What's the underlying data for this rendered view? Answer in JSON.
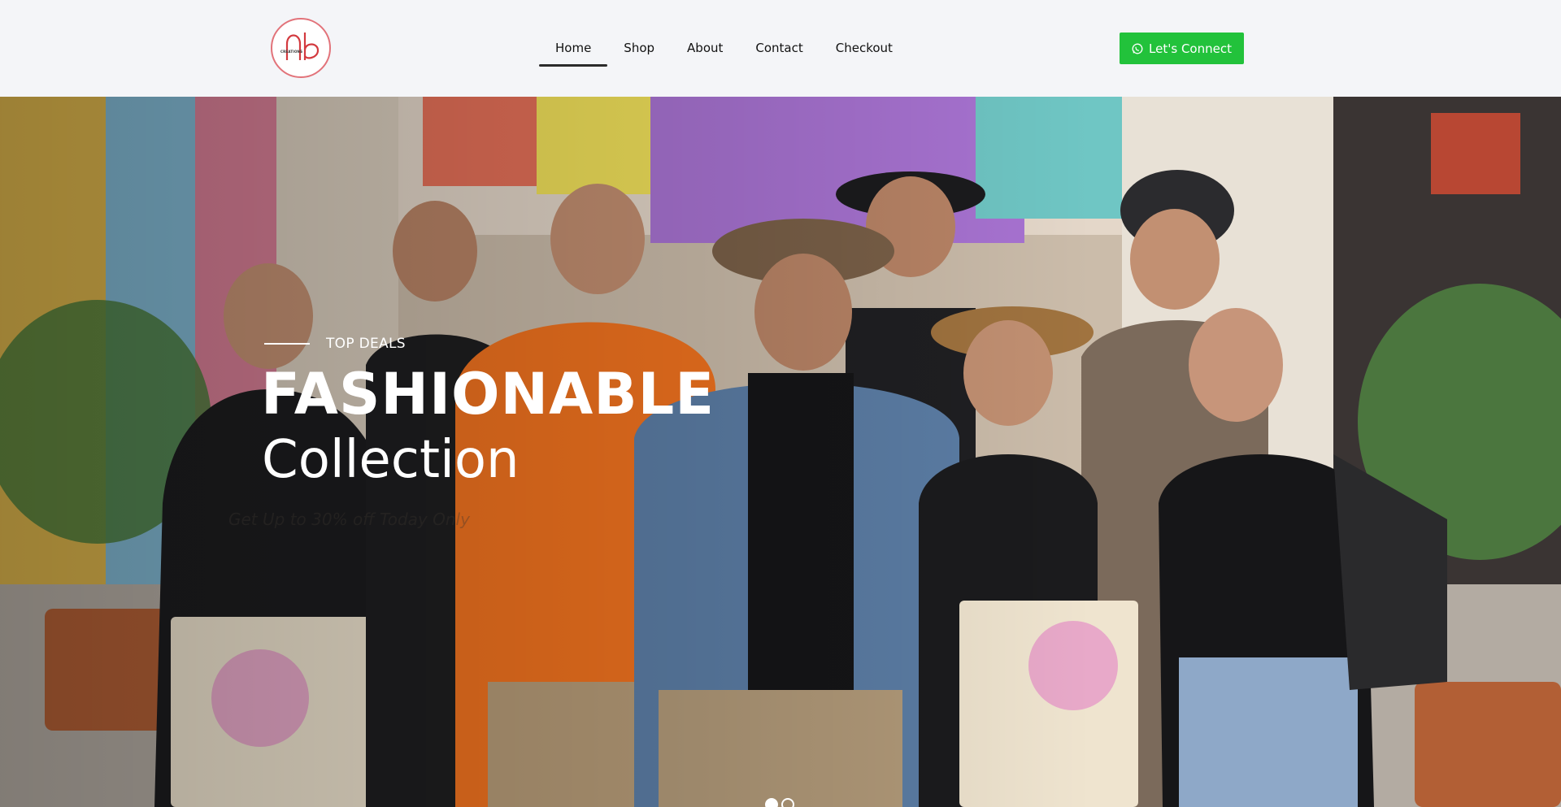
{
  "brand": {
    "logo_text": "CREATIONS",
    "logo_color": "#e2737a"
  },
  "nav": {
    "items": [
      {
        "label": "Home",
        "active": true
      },
      {
        "label": "Shop",
        "active": false
      },
      {
        "label": "About",
        "active": false
      },
      {
        "label": "Contact",
        "active": false
      },
      {
        "label": "Checkout",
        "active": false
      }
    ]
  },
  "cta": {
    "label": "Let's Connect",
    "icon": "whatsapp-icon",
    "color": "#22c23b"
  },
  "hero": {
    "eyebrow": "TOP DEALS",
    "title": "FASHIONABLE",
    "subtitle": "Collection",
    "tagline": "Get Up to 30% off Today Only",
    "image": "group-of-young-people-with-hats-and-tote-bags-street-photo",
    "slides": [
      {
        "active": true
      },
      {
        "active": false
      }
    ]
  }
}
